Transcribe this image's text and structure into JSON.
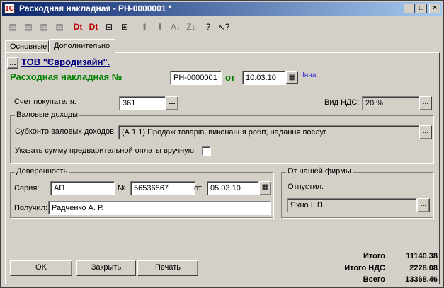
{
  "window": {
    "title": "Расходная накладная - РН-0000001 *",
    "app_icon": "1С",
    "min": "_",
    "max": "□",
    "close": "×"
  },
  "toolbar": [
    {
      "name": "new-row-icon",
      "glyph": "▤"
    },
    {
      "name": "copy-row-icon",
      "glyph": "▤"
    },
    {
      "name": "delete-row-icon",
      "glyph": "▤"
    },
    {
      "name": "edit-row-icon",
      "glyph": "▤"
    },
    {
      "name": "dt-kt-icon",
      "glyph": "Dt"
    },
    {
      "name": "dt-kt-movements-icon",
      "glyph": "Dt"
    },
    {
      "name": "register-icon",
      "glyph": "⊟"
    },
    {
      "name": "split-icon",
      "glyph": "⊞"
    },
    {
      "name": "move-up-icon",
      "glyph": "⬆"
    },
    {
      "name": "move-down-icon",
      "glyph": "⬇"
    },
    {
      "name": "sort-asc-icon",
      "glyph": "A↓"
    },
    {
      "name": "sort-desc-icon",
      "glyph": "Z↓"
    },
    {
      "name": "help-icon",
      "glyph": "?"
    },
    {
      "name": "context-help-icon",
      "glyph": "↖?"
    }
  ],
  "tabs": {
    "main": "Основные",
    "extra": "Дополнительно"
  },
  "header": {
    "org_button": "...",
    "org_name": "ТОВ \"Євродизайн\".",
    "doc_title": "Расходная накладная №",
    "doc_number": "РН-0000001",
    "date_label": "от",
    "date": "10.03.10",
    "author": "Інна"
  },
  "account": {
    "label": "Счет покупателя:",
    "value": "361"
  },
  "vat": {
    "label": "Вид НДС:",
    "value": "20 %"
  },
  "gross_income": {
    "group_title": "Валовые доходы",
    "subconto_label": "Субконто валовых доходов:",
    "subconto_value": "(А 1.1) Продаж товарів, виконання робіт, надання послуг",
    "prepay_label": "Указать сумму предварительной оплаты вручную:"
  },
  "power_of_attorney": {
    "group_title": "Доверенность",
    "series_label": "Серия:",
    "series_value": "АП",
    "number_label": "№",
    "number_value": "56536867",
    "date_label": "от",
    "date_value": "05.03.10",
    "received_label": "Получил:",
    "received_value": "Радченко А. Р."
  },
  "from_company": {
    "group_title": "От нашей фирмы",
    "released_label": "Отпустил:",
    "released_value": "Яхно І. П."
  },
  "buttons": {
    "ok": "OK",
    "close": "Закрыть",
    "print": "Печать",
    "dots": "..."
  },
  "totals": {
    "total_label": "Итого",
    "total_value": "11140.38",
    "vat_label": "Итого НДС",
    "vat_value": "2228.08",
    "sum_label": "Всего",
    "sum_value": "13368.46"
  },
  "colors": {
    "doc_title": "#008000",
    "org_link": "#000080",
    "author": "#3333cc",
    "title_bar": "#0a246a"
  }
}
